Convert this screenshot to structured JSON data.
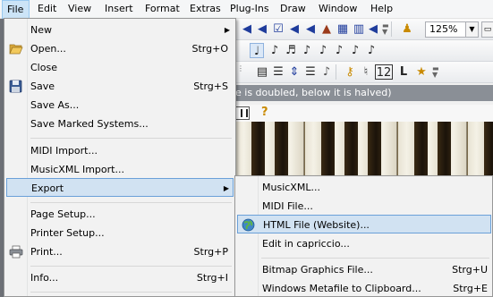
{
  "menubar": {
    "items": [
      {
        "label": "File"
      },
      {
        "label": "Edit"
      },
      {
        "label": "View"
      },
      {
        "label": "Insert"
      },
      {
        "label": "Format"
      },
      {
        "label": "Extras"
      },
      {
        "label": "Plug-Ins"
      },
      {
        "label": "Draw"
      },
      {
        "label": "Window"
      },
      {
        "label": "Help"
      }
    ],
    "active_index": 0
  },
  "toolbar": {
    "zoom_value": "125%",
    "measure_number": "12",
    "style_letter": "L"
  },
  "status_bar": {
    "text": "e is doubled, below it is halved)"
  },
  "file_menu": {
    "items": [
      {
        "label": "New",
        "shortcut": "",
        "submenu": true
      },
      {
        "label": "Open...",
        "shortcut": "Strg+O",
        "icon": "open-folder-icon"
      },
      {
        "label": "Close",
        "shortcut": ""
      },
      {
        "label": "Save",
        "shortcut": "Strg+S",
        "icon": "floppy-disk-icon"
      },
      {
        "label": "Save As...",
        "shortcut": ""
      },
      {
        "label": "Save Marked Systems...",
        "shortcut": ""
      },
      {
        "label": "MIDI Import...",
        "shortcut": ""
      },
      {
        "label": "MusicXML Import...",
        "shortcut": ""
      },
      {
        "label": "Export",
        "shortcut": "",
        "submenu": true,
        "highlighted": true
      },
      {
        "label": "Page Setup...",
        "shortcut": ""
      },
      {
        "label": "Printer Setup...",
        "shortcut": ""
      },
      {
        "label": "Print...",
        "shortcut": "Strg+P",
        "icon": "printer-icon"
      },
      {
        "label": "Info...",
        "shortcut": "Strg+I"
      }
    ]
  },
  "export_submenu": {
    "items": [
      {
        "label": "MusicXML...",
        "shortcut": ""
      },
      {
        "label": "MIDI File...",
        "shortcut": ""
      },
      {
        "label": "HTML File (Website)...",
        "shortcut": "",
        "icon": "globe-icon",
        "highlighted": true
      },
      {
        "label": "Edit in capriccio...",
        "shortcut": ""
      },
      {
        "label": "Bitmap Graphics File...",
        "shortcut": "Strg+U"
      },
      {
        "label": "Windows Metafile to Clipboard...",
        "shortcut": "Strg+E"
      }
    ]
  },
  "colors": {
    "highlight_bg": "#d1e2f2",
    "highlight_border": "#6aa0d8",
    "menu_bg": "#f2f2f2"
  }
}
